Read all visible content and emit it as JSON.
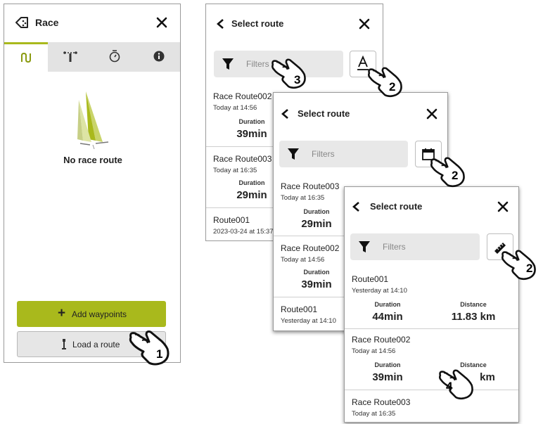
{
  "race_panel": {
    "title": "Race",
    "tabs": [
      {
        "icon": "route-icon",
        "active": true
      },
      {
        "icon": "start-line-icon",
        "active": false
      },
      {
        "icon": "timer-icon",
        "active": false
      },
      {
        "icon": "info-icon",
        "active": false
      }
    ],
    "empty_text": "No race route",
    "add_button": "Add waypoints",
    "load_button": "Load a route"
  },
  "select_route": {
    "title": "Select route",
    "filter_placeholder": "Filters"
  },
  "panel_a": {
    "routes": [
      {
        "name": "Race Route002",
        "time": "Today at 14:56",
        "duration_label": "Duration",
        "duration": "39min"
      },
      {
        "name": "Race Route003",
        "time": "Today at 16:35",
        "duration_label": "Duration",
        "duration": "29min"
      },
      {
        "name": "Route001",
        "time": "2023-03-24 at 15:37"
      }
    ]
  },
  "panel_b": {
    "routes": [
      {
        "name": "Race Route003",
        "time": "Today at 16:35",
        "duration_label": "Duration",
        "duration": "29min"
      },
      {
        "name": "Race Route002",
        "time": "Today at 14:56",
        "duration_label": "Duration",
        "duration": "39min"
      },
      {
        "name": "Route001",
        "time": "Yesterday at 14:10"
      }
    ]
  },
  "panel_c": {
    "routes": [
      {
        "name": "Route001",
        "time": "Yesterday at 14:10",
        "duration_label": "Duration",
        "duration": "44min",
        "distance_label": "Distance",
        "distance": "11.83 km"
      },
      {
        "name": "Race Route002",
        "time": "Today at 14:56",
        "duration_label": "Duration",
        "duration": "39min",
        "distance_label": "Distance",
        "distance": "km"
      },
      {
        "name": "Race Route003",
        "time": "Today at 16:35"
      }
    ]
  },
  "callouts": [
    "1",
    "3",
    "2",
    "2",
    "2",
    "4"
  ],
  "colors": {
    "accent_green": "#a9b91c",
    "tab_bar_gray": "#e3e3e3",
    "load_button_gray": "#e6e6e6",
    "filter_gray": "#e8e8e8"
  }
}
